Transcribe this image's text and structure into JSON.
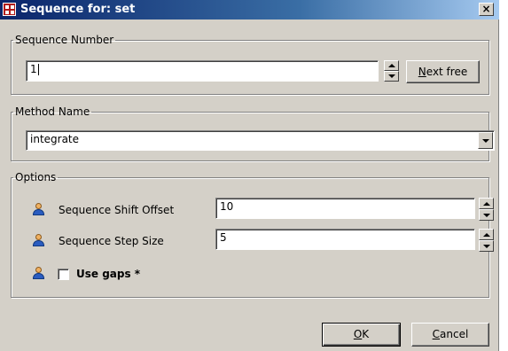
{
  "window": {
    "title": "Sequence for: set",
    "close_label": "×"
  },
  "sequence_number": {
    "legend": "Sequence Number",
    "value": "1",
    "next_free_label": "Next free",
    "next_free_mnemonic": "N",
    "next_free_rest": "ext free"
  },
  "method_name": {
    "legend": "Method Name",
    "value": "integrate"
  },
  "options": {
    "legend": "Options",
    "shift_offset_label": "Sequence Shift Offset",
    "shift_offset_value": "10",
    "step_size_label": "Sequence Step Size",
    "step_size_value": "5",
    "use_gaps_label": "Use gaps *",
    "use_gaps_checked": false
  },
  "buttons": {
    "ok_mnemonic": "O",
    "ok_rest": "K",
    "cancel_mnemonic": "C",
    "cancel_rest": "ancel"
  },
  "icons": {
    "title_icon": "sequence-app-icon",
    "user_icon": "user-icon"
  }
}
